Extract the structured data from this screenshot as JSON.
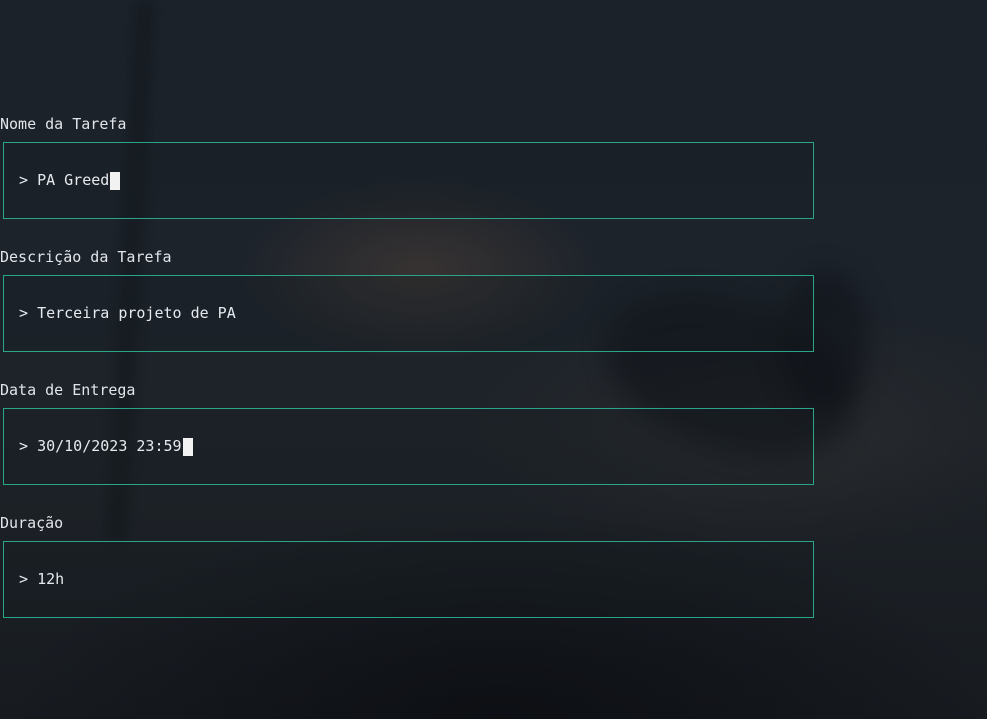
{
  "fields": [
    {
      "label": "Nome da Tarefa",
      "prompt": "> ",
      "value": "PA Greed",
      "focused": true
    },
    {
      "label": "Descrição da Tarefa",
      "prompt": "> ",
      "value": "Terceira projeto de PA",
      "focused": false
    },
    {
      "label": "Data de Entrega",
      "prompt": "> ",
      "value": "30/10/2023 23:59",
      "focused": true
    },
    {
      "label": "Duração",
      "prompt": "> ",
      "value": "12h",
      "focused": false
    }
  ],
  "colors": {
    "border": "#2aa58a",
    "text": "#e1e5ea",
    "background": "#1a1f26"
  }
}
